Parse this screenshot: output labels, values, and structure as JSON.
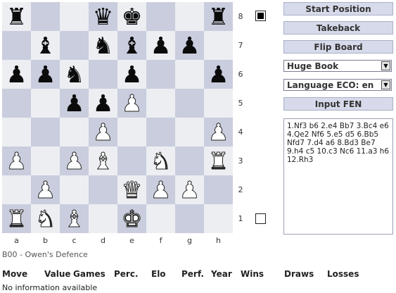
{
  "board": {
    "ranks": [
      "8",
      "7",
      "6",
      "5",
      "4",
      "3",
      "2",
      "1"
    ],
    "files": [
      "a",
      "b",
      "c",
      "d",
      "e",
      "f",
      "g",
      "h"
    ],
    "rows": [
      [
        "bR",
        "",
        "",
        "bQ",
        "bK",
        "",
        "",
        "bR"
      ],
      [
        "",
        "bB",
        "",
        "bN",
        "bB",
        "bP",
        "bP",
        ""
      ],
      [
        "bP",
        "bP",
        "bN",
        "",
        "bP",
        "",
        "",
        "bP"
      ],
      [
        "",
        "",
        "bP",
        "bP",
        "wP",
        "",
        "",
        ""
      ],
      [
        "",
        "",
        "",
        "wP",
        "",
        "",
        "",
        "wP"
      ],
      [
        "wP",
        "",
        "wP",
        "wB",
        "",
        "wN",
        "",
        "wR"
      ],
      [
        "",
        "wP",
        "",
        "",
        "wQ",
        "wP",
        "wP",
        ""
      ],
      [
        "wR",
        "wN",
        "wB",
        "",
        "wK",
        "",
        "",
        ""
      ]
    ],
    "glyphs": {
      "K": "♚",
      "Q": "♛",
      "R": "♜",
      "B": "♝",
      "N": "♞",
      "P": "♟"
    }
  },
  "buttons": {
    "start": "Start Position",
    "takeback": "Takeback",
    "flip": "Flip Board",
    "input_fen": "Input FEN"
  },
  "selects": {
    "book": "Huge Book",
    "language": "Language ECO: en"
  },
  "moves_text": "1.Nf3 b6 2.e4 Bb7 3.Bc4 e6 4.Qe2 Nf6 5.e5 d5 6.Bb5 Nfd7 7.d4 a6 8.Bd3 Be7 9.h4 c5 10.c3 Nc6 11.a3 h6 12.Rh3",
  "opening": "B00 - Owen's Defence",
  "table": {
    "headers": [
      "Move",
      "Value",
      "Games",
      "Perc.",
      "Elo",
      "Perf.",
      "Year",
      "Wins",
      "Draws",
      "Losses"
    ],
    "empty_text": "No information available"
  }
}
